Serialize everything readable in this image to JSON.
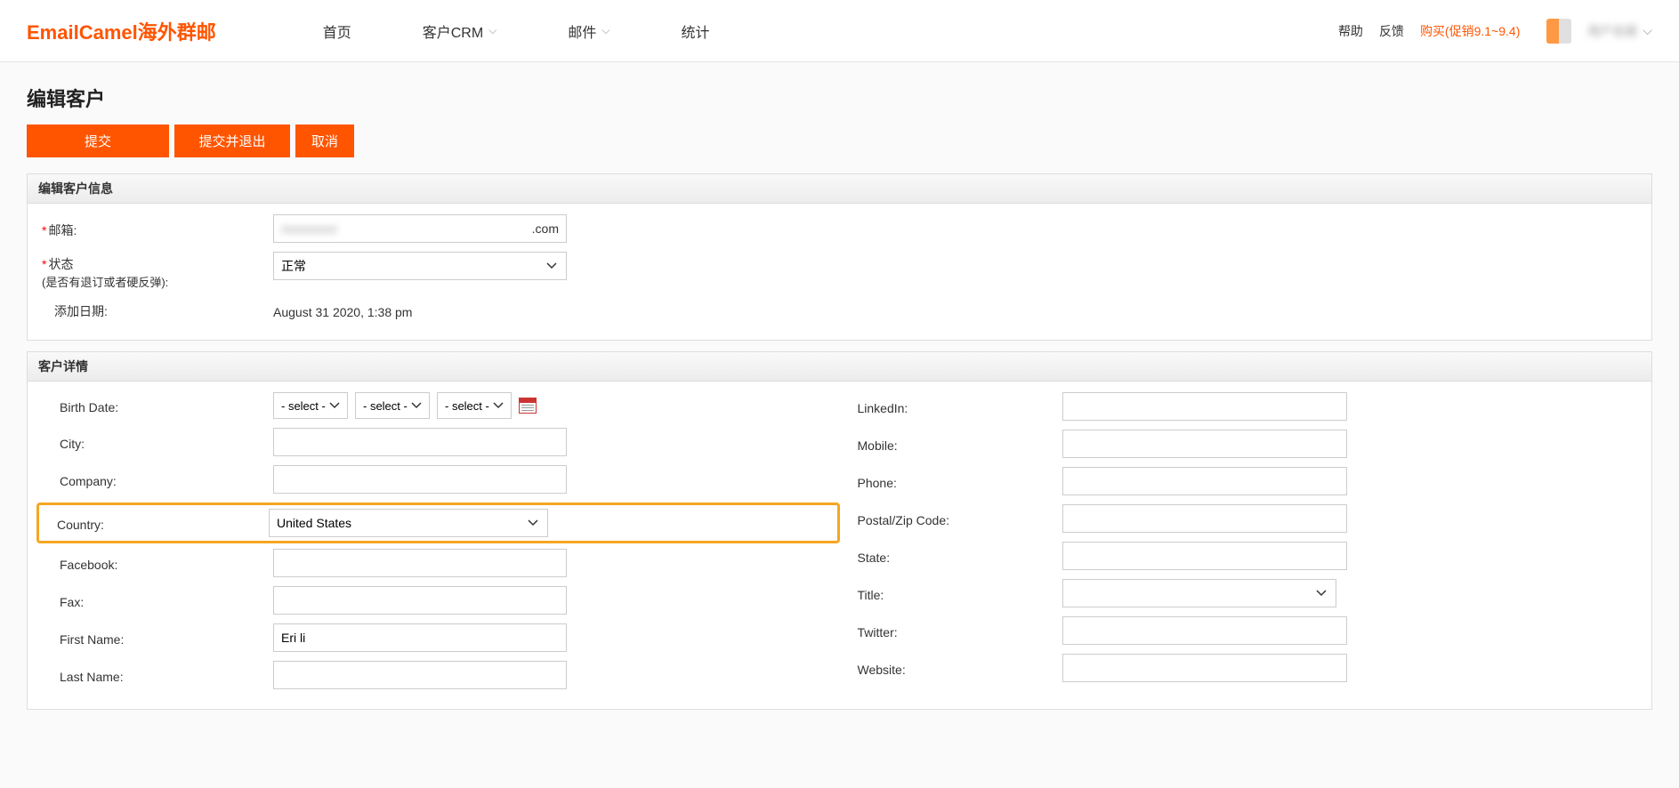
{
  "header": {
    "logo": "EmailCamel海外群邮",
    "nav": [
      {
        "label": "首页",
        "has_chev": false
      },
      {
        "label": "客户CRM",
        "has_chev": true
      },
      {
        "label": "邮件",
        "has_chev": true
      },
      {
        "label": "统计",
        "has_chev": false
      }
    ],
    "help": "帮助",
    "feedback": "反馈",
    "promo": "购买(促销9.1~9.4)"
  },
  "page": {
    "title": "编辑客户",
    "btn_submit": "提交",
    "btn_submit_exit": "提交并退出",
    "btn_cancel": "取消"
  },
  "section1": {
    "title": "编辑客户信息",
    "email_label": "邮箱:",
    "email_value_suffix": ".com",
    "status_label": "状态",
    "status_sub": "(是否有退订或者硬反弹):",
    "status_value": "正常",
    "date_label": "添加日期:",
    "date_value": "August 31 2020, 1:38 pm"
  },
  "section2": {
    "title": "客户详情",
    "select_placeholder": "- select -",
    "left": {
      "birth_date": "Birth Date:",
      "city": "City:",
      "company": "Company:",
      "country": "Country:",
      "country_value": "United States",
      "facebook": "Facebook:",
      "fax": "Fax:",
      "first_name": "First Name:",
      "first_name_value": "Eri li",
      "last_name": "Last Name:"
    },
    "right": {
      "linkedin": "LinkedIn:",
      "mobile": "Mobile:",
      "phone": "Phone:",
      "postal": "Postal/Zip Code:",
      "state": "State:",
      "title": "Title:",
      "twitter": "Twitter:",
      "website": "Website:"
    }
  }
}
